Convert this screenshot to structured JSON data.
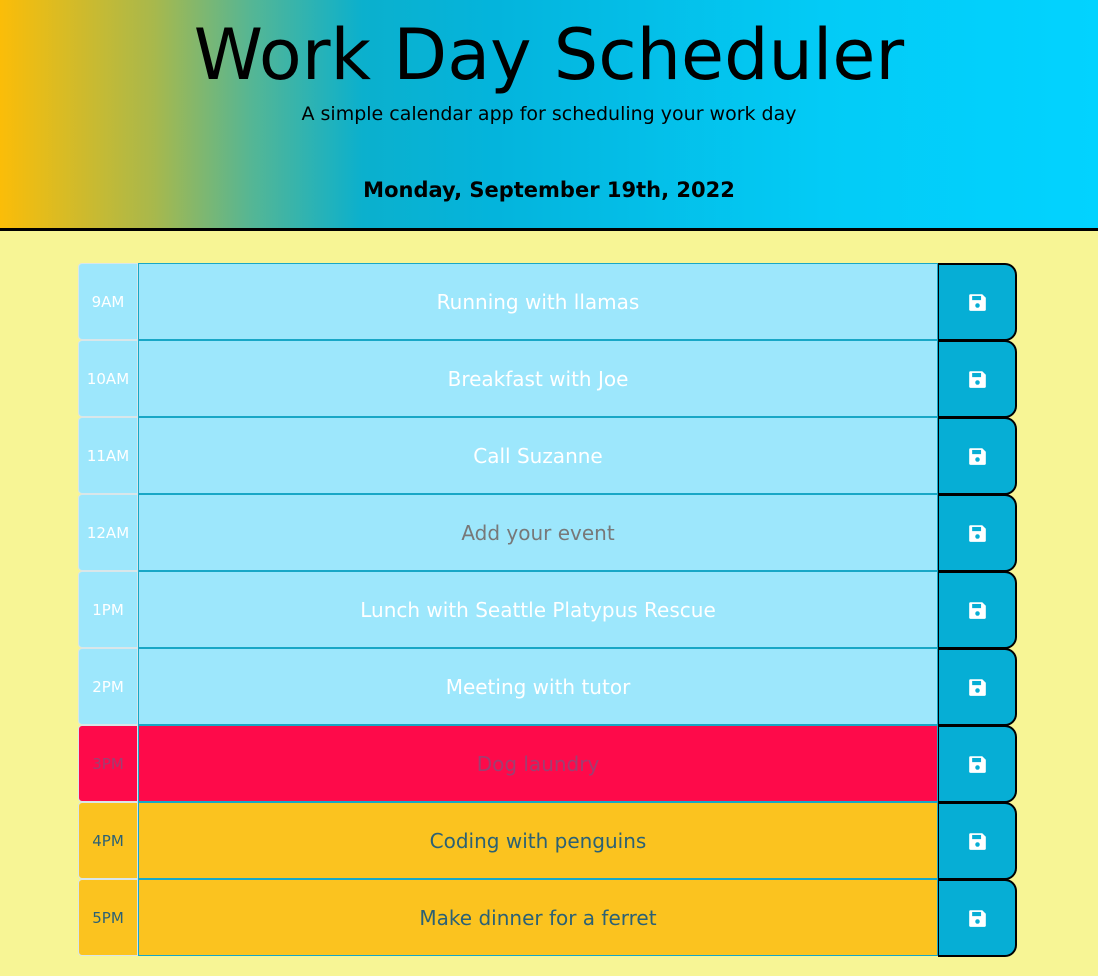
{
  "header": {
    "title": "Work Day Scheduler",
    "subtitle": "A simple calendar app for scheduling your work day",
    "current_day": "Monday, September 19th, 2022"
  },
  "colors": {
    "background": "#f7f595",
    "past": "#9de7fc",
    "present": "#fe0a4a",
    "future": "#fbc31f",
    "save_button": "#06aed5"
  },
  "save_icon": "floppy-disk-icon",
  "timeblocks": [
    {
      "hour": "9AM",
      "event": "Running with llamas",
      "state": "past"
    },
    {
      "hour": "10AM",
      "event": "Breakfast with Joe",
      "state": "past"
    },
    {
      "hour": "11AM",
      "event": "Call Suzanne",
      "state": "past"
    },
    {
      "hour": "12AM",
      "event": "",
      "placeholder": "Add your event",
      "state": "past"
    },
    {
      "hour": "1PM",
      "event": "Lunch with Seattle Platypus Rescue",
      "state": "past"
    },
    {
      "hour": "2PM",
      "event": "Meeting with tutor",
      "state": "past"
    },
    {
      "hour": "3PM",
      "event": "Dog laundry",
      "state": "present"
    },
    {
      "hour": "4PM",
      "event": "Coding with penguins",
      "state": "future"
    },
    {
      "hour": "5PM",
      "event": "Make dinner for a ferret",
      "state": "future"
    }
  ]
}
